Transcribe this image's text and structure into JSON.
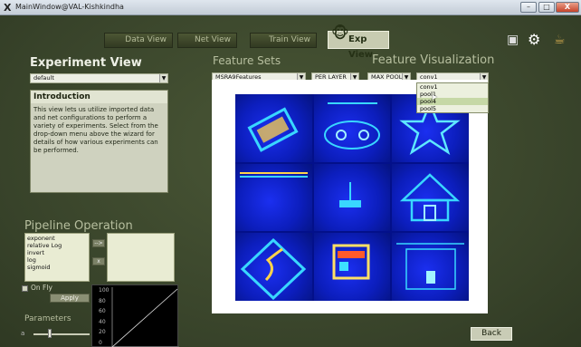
{
  "window": {
    "title": "MainWindow@VAL-Kishkindha",
    "app_icon": "X",
    "buttons": {
      "minimize": "–",
      "maximize": "□",
      "close": "X"
    }
  },
  "toolbar": {
    "data_view": "Data View",
    "net_view": "Net View",
    "train_view": "Train View",
    "exp_view": "Exp View",
    "icons": [
      "bag-icon",
      "gear-icon",
      "coffee-icon"
    ]
  },
  "experiment": {
    "heading": "Experiment View",
    "select_value": "default",
    "intro_title": "Introduction",
    "intro_text": "This view lets us utilize imported data and net configurations to perform a variety of experiments. Select from the drop-down menu above the wizard for details of how various experiments can be performed."
  },
  "feature_sets": {
    "heading": "Feature Sets",
    "dataset": "MSRA9Features",
    "mode": "PER LAYER",
    "pool": "MAX POOL"
  },
  "feature_visualization": {
    "heading": "Feature Visualization",
    "layer_value": "conv1",
    "layer_options": [
      "conv1",
      "pool1",
      "pool4",
      "pool5"
    ],
    "highlighted_option": "pool4"
  },
  "pipeline": {
    "heading": "Pipeline Operation",
    "operations": [
      "exponent",
      "relative Log",
      "invert",
      "log",
      "sigmoid"
    ],
    "add_label": "-->",
    "remove_label": "x",
    "on_fly_label": "On Fly",
    "apply_label": "Apply",
    "parameters_label": "Parameters",
    "param_symbol": "a",
    "graph_ticks": [
      "100",
      "80",
      "60",
      "40",
      "20",
      "0"
    ]
  },
  "footer": {
    "back_label": "Back"
  }
}
